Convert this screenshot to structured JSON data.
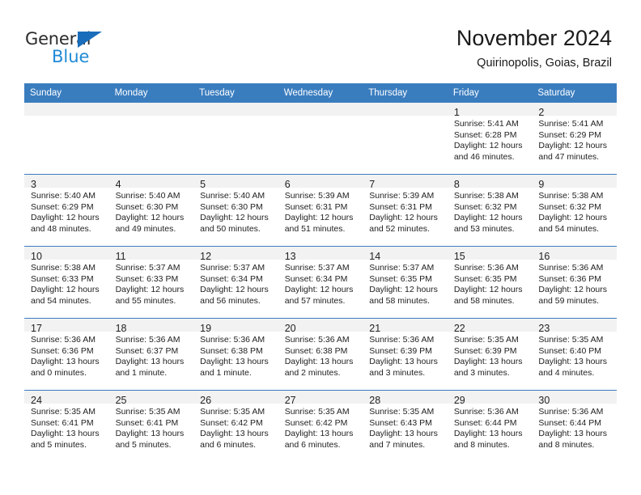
{
  "brand": {
    "name_part1": "General",
    "name_part2": "Blue",
    "triangle_color": "#1a6dbb",
    "blue_color": "#1f8ad6"
  },
  "header": {
    "month_title": "November 2024",
    "location": "Quirinopolis, Goias, Brazil"
  },
  "theme": {
    "header_blue": "#3a7dbf",
    "daynum_band": "#f2f2f2",
    "text": "#222222"
  },
  "weekday_headers": [
    "Sunday",
    "Monday",
    "Tuesday",
    "Wednesday",
    "Thursday",
    "Friday",
    "Saturday"
  ],
  "weeks": [
    [
      {
        "day": "",
        "empty": true
      },
      {
        "day": "",
        "empty": true
      },
      {
        "day": "",
        "empty": true
      },
      {
        "day": "",
        "empty": true
      },
      {
        "day": "",
        "empty": true
      },
      {
        "day": "1",
        "sunrise": "Sunrise: 5:41 AM",
        "sunset": "Sunset: 6:28 PM",
        "daylight1": "Daylight: 12 hours",
        "daylight2": "and 46 minutes."
      },
      {
        "day": "2",
        "sunrise": "Sunrise: 5:41 AM",
        "sunset": "Sunset: 6:29 PM",
        "daylight1": "Daylight: 12 hours",
        "daylight2": "and 47 minutes."
      }
    ],
    [
      {
        "day": "3",
        "sunrise": "Sunrise: 5:40 AM",
        "sunset": "Sunset: 6:29 PM",
        "daylight1": "Daylight: 12 hours",
        "daylight2": "and 48 minutes."
      },
      {
        "day": "4",
        "sunrise": "Sunrise: 5:40 AM",
        "sunset": "Sunset: 6:30 PM",
        "daylight1": "Daylight: 12 hours",
        "daylight2": "and 49 minutes."
      },
      {
        "day": "5",
        "sunrise": "Sunrise: 5:40 AM",
        "sunset": "Sunset: 6:30 PM",
        "daylight1": "Daylight: 12 hours",
        "daylight2": "and 50 minutes."
      },
      {
        "day": "6",
        "sunrise": "Sunrise: 5:39 AM",
        "sunset": "Sunset: 6:31 PM",
        "daylight1": "Daylight: 12 hours",
        "daylight2": "and 51 minutes."
      },
      {
        "day": "7",
        "sunrise": "Sunrise: 5:39 AM",
        "sunset": "Sunset: 6:31 PM",
        "daylight1": "Daylight: 12 hours",
        "daylight2": "and 52 minutes."
      },
      {
        "day": "8",
        "sunrise": "Sunrise: 5:38 AM",
        "sunset": "Sunset: 6:32 PM",
        "daylight1": "Daylight: 12 hours",
        "daylight2": "and 53 minutes."
      },
      {
        "day": "9",
        "sunrise": "Sunrise: 5:38 AM",
        "sunset": "Sunset: 6:32 PM",
        "daylight1": "Daylight: 12 hours",
        "daylight2": "and 54 minutes."
      }
    ],
    [
      {
        "day": "10",
        "sunrise": "Sunrise: 5:38 AM",
        "sunset": "Sunset: 6:33 PM",
        "daylight1": "Daylight: 12 hours",
        "daylight2": "and 54 minutes."
      },
      {
        "day": "11",
        "sunrise": "Sunrise: 5:37 AM",
        "sunset": "Sunset: 6:33 PM",
        "daylight1": "Daylight: 12 hours",
        "daylight2": "and 55 minutes."
      },
      {
        "day": "12",
        "sunrise": "Sunrise: 5:37 AM",
        "sunset": "Sunset: 6:34 PM",
        "daylight1": "Daylight: 12 hours",
        "daylight2": "and 56 minutes."
      },
      {
        "day": "13",
        "sunrise": "Sunrise: 5:37 AM",
        "sunset": "Sunset: 6:34 PM",
        "daylight1": "Daylight: 12 hours",
        "daylight2": "and 57 minutes."
      },
      {
        "day": "14",
        "sunrise": "Sunrise: 5:37 AM",
        "sunset": "Sunset: 6:35 PM",
        "daylight1": "Daylight: 12 hours",
        "daylight2": "and 58 minutes."
      },
      {
        "day": "15",
        "sunrise": "Sunrise: 5:36 AM",
        "sunset": "Sunset: 6:35 PM",
        "daylight1": "Daylight: 12 hours",
        "daylight2": "and 58 minutes."
      },
      {
        "day": "16",
        "sunrise": "Sunrise: 5:36 AM",
        "sunset": "Sunset: 6:36 PM",
        "daylight1": "Daylight: 12 hours",
        "daylight2": "and 59 minutes."
      }
    ],
    [
      {
        "day": "17",
        "sunrise": "Sunrise: 5:36 AM",
        "sunset": "Sunset: 6:36 PM",
        "daylight1": "Daylight: 13 hours",
        "daylight2": "and 0 minutes."
      },
      {
        "day": "18",
        "sunrise": "Sunrise: 5:36 AM",
        "sunset": "Sunset: 6:37 PM",
        "daylight1": "Daylight: 13 hours",
        "daylight2": "and 1 minute."
      },
      {
        "day": "19",
        "sunrise": "Sunrise: 5:36 AM",
        "sunset": "Sunset: 6:38 PM",
        "daylight1": "Daylight: 13 hours",
        "daylight2": "and 1 minute."
      },
      {
        "day": "20",
        "sunrise": "Sunrise: 5:36 AM",
        "sunset": "Sunset: 6:38 PM",
        "daylight1": "Daylight: 13 hours",
        "daylight2": "and 2 minutes."
      },
      {
        "day": "21",
        "sunrise": "Sunrise: 5:36 AM",
        "sunset": "Sunset: 6:39 PM",
        "daylight1": "Daylight: 13 hours",
        "daylight2": "and 3 minutes."
      },
      {
        "day": "22",
        "sunrise": "Sunrise: 5:35 AM",
        "sunset": "Sunset: 6:39 PM",
        "daylight1": "Daylight: 13 hours",
        "daylight2": "and 3 minutes."
      },
      {
        "day": "23",
        "sunrise": "Sunrise: 5:35 AM",
        "sunset": "Sunset: 6:40 PM",
        "daylight1": "Daylight: 13 hours",
        "daylight2": "and 4 minutes."
      }
    ],
    [
      {
        "day": "24",
        "sunrise": "Sunrise: 5:35 AM",
        "sunset": "Sunset: 6:41 PM",
        "daylight1": "Daylight: 13 hours",
        "daylight2": "and 5 minutes."
      },
      {
        "day": "25",
        "sunrise": "Sunrise: 5:35 AM",
        "sunset": "Sunset: 6:41 PM",
        "daylight1": "Daylight: 13 hours",
        "daylight2": "and 5 minutes."
      },
      {
        "day": "26",
        "sunrise": "Sunrise: 5:35 AM",
        "sunset": "Sunset: 6:42 PM",
        "daylight1": "Daylight: 13 hours",
        "daylight2": "and 6 minutes."
      },
      {
        "day": "27",
        "sunrise": "Sunrise: 5:35 AM",
        "sunset": "Sunset: 6:42 PM",
        "daylight1": "Daylight: 13 hours",
        "daylight2": "and 6 minutes."
      },
      {
        "day": "28",
        "sunrise": "Sunrise: 5:35 AM",
        "sunset": "Sunset: 6:43 PM",
        "daylight1": "Daylight: 13 hours",
        "daylight2": "and 7 minutes."
      },
      {
        "day": "29",
        "sunrise": "Sunrise: 5:36 AM",
        "sunset": "Sunset: 6:44 PM",
        "daylight1": "Daylight: 13 hours",
        "daylight2": "and 8 minutes."
      },
      {
        "day": "30",
        "sunrise": "Sunrise: 5:36 AM",
        "sunset": "Sunset: 6:44 PM",
        "daylight1": "Daylight: 13 hours",
        "daylight2": "and 8 minutes."
      }
    ]
  ]
}
